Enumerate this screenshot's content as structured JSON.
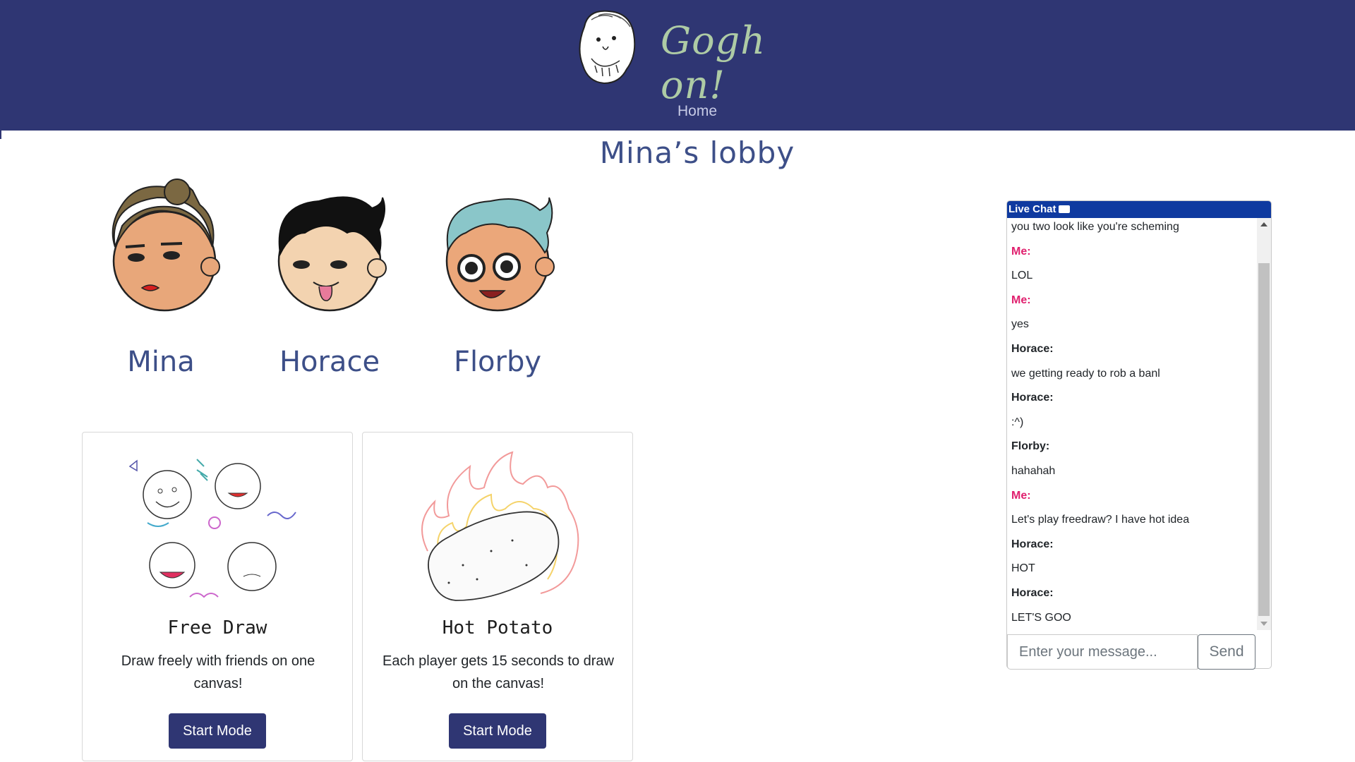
{
  "header": {
    "logo_text": "Gogh on!",
    "nav_home": "Home",
    "color": "#2f3673"
  },
  "lobby": {
    "title": "Mina’s lobby"
  },
  "players": [
    {
      "name": "Mina",
      "icon": "mina-avatar-icon"
    },
    {
      "name": "Horace",
      "icon": "horace-avatar-icon"
    },
    {
      "name": "Florby",
      "icon": "florby-avatar-icon"
    }
  ],
  "modes": [
    {
      "title": "Free Draw",
      "description": "Draw freely with friends on one canvas!",
      "button": "Start Mode",
      "icon": "doodle-faces-illustration"
    },
    {
      "title": "Hot Potato",
      "description": "Each player gets 15 seconds to draw on the canvas!",
      "button": "Start Mode",
      "icon": "flaming-potato-illustration"
    }
  ],
  "chat": {
    "title": "Live Chat",
    "messages": [
      {
        "text": "you two look like you're scheming",
        "type": "text"
      },
      {
        "text": "Me:",
        "type": "me"
      },
      {
        "text": "LOL",
        "type": "text"
      },
      {
        "text": "Me:",
        "type": "me"
      },
      {
        "text": "yes",
        "type": "text"
      },
      {
        "text": "Horace:",
        "type": "sender"
      },
      {
        "text": "we getting ready to rob a banl",
        "type": "text"
      },
      {
        "text": "Horace:",
        "type": "sender"
      },
      {
        "text": ":^)",
        "type": "text"
      },
      {
        "text": "Florby:",
        "type": "sender"
      },
      {
        "text": "hahahah",
        "type": "text"
      },
      {
        "text": "Me:",
        "type": "me"
      },
      {
        "text": "Let's play freedraw? I have hot idea",
        "type": "text"
      },
      {
        "text": "Horace:",
        "type": "sender"
      },
      {
        "text": "HOT",
        "type": "text"
      },
      {
        "text": "Horace:",
        "type": "sender"
      },
      {
        "text": "LET'S GOO",
        "type": "text"
      }
    ],
    "input_placeholder": "Enter your message...",
    "send_label": "Send",
    "me_color": "#e0206e",
    "header_color": "#0f3aa0"
  }
}
